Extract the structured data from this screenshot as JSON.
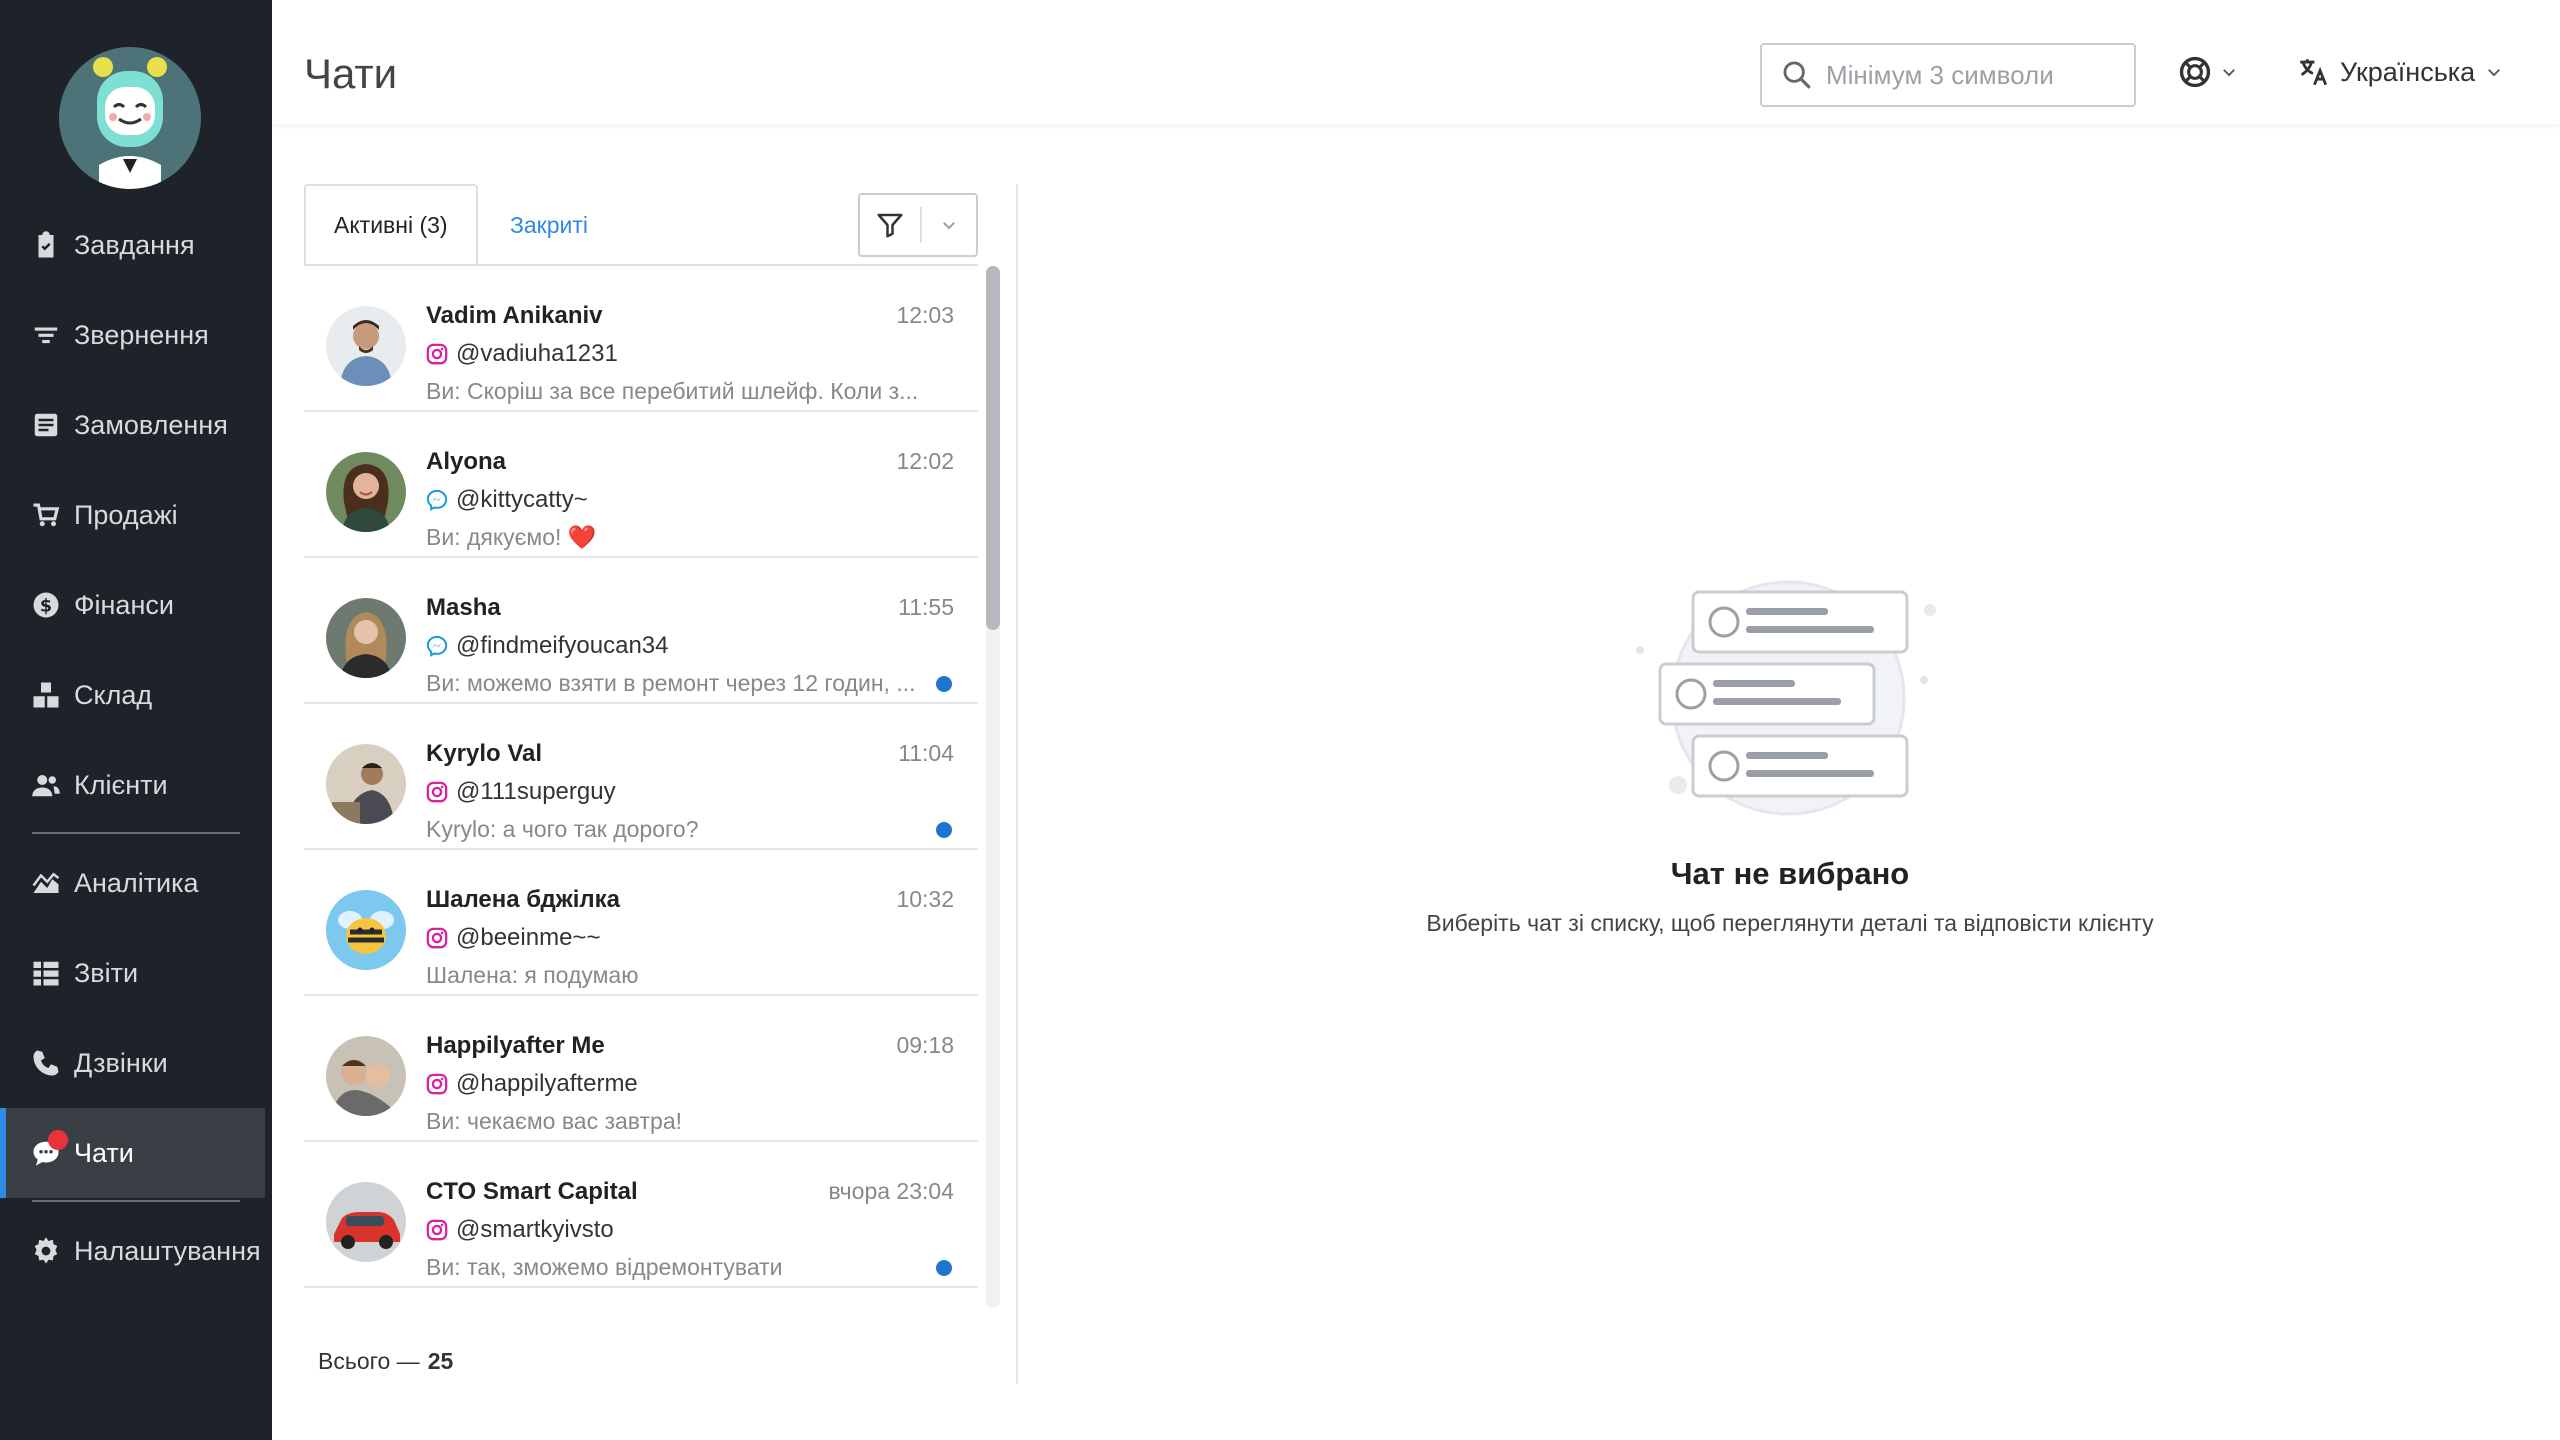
{
  "sidebar": {
    "items": [
      {
        "label": "Завдання",
        "icon": "clipboard-check-icon"
      },
      {
        "label": "Звернення",
        "icon": "filter-lines-icon"
      },
      {
        "label": "Замовлення",
        "icon": "order-list-icon"
      },
      {
        "label": "Продажі",
        "icon": "cart-icon"
      },
      {
        "label": "Фінанси",
        "icon": "dollar-icon"
      },
      {
        "label": "Склад",
        "icon": "boxes-icon"
      },
      {
        "label": "Клієнти",
        "icon": "users-icon"
      },
      {
        "label": "Аналітика",
        "icon": "area-chart-icon"
      },
      {
        "label": "Звіти",
        "icon": "table-report-icon"
      },
      {
        "label": "Дзвінки",
        "icon": "phone-icon"
      },
      {
        "label": "Чати",
        "icon": "chat-icon"
      },
      {
        "label": "Налаштування",
        "icon": "gear-icon"
      }
    ],
    "active": "Чати"
  },
  "header": {
    "title": "Чати",
    "search_placeholder": "Мінімум 3 символи",
    "language": "Українська"
  },
  "tabs": {
    "active": "Активні (3)",
    "closed": "Закриті"
  },
  "chats": [
    {
      "name": "Vadim Anikaniv",
      "time": "12:03",
      "handle": "@vadiuha1231",
      "source": "instagram",
      "message": "Ви: Скоріш за все перебитий шлейф. Коли з...",
      "unread": false
    },
    {
      "name": "Alyona",
      "time": "12:02",
      "handle": "@kittycatty~",
      "source": "messenger",
      "message": "Ви: дякуємо! ❤️",
      "unread": false
    },
    {
      "name": "Masha",
      "time": "11:55",
      "handle": "@findmeifyoucan34",
      "source": "messenger",
      "message": "Ви: можемо взяти в ремонт через 12 годин, ...",
      "unread": true
    },
    {
      "name": "Kyrylo Val",
      "time": "11:04",
      "handle": "@111superguy",
      "source": "instagram",
      "message": "Kyrylo: а чого так дорого?",
      "unread": true
    },
    {
      "name": "Шалена бджілка",
      "time": "10:32",
      "handle": "@beeinme~~",
      "source": "instagram",
      "message": "Шалена: я подумаю",
      "unread": false
    },
    {
      "name": "Happilyafter Me",
      "time": "09:18",
      "handle": "@happilyafterme",
      "source": "instagram",
      "message": "Ви: чекаємо вас завтра!",
      "unread": false
    },
    {
      "name": "CTO Smart Capital",
      "time": "вчора 23:04",
      "handle": "@smartkyivsto",
      "source": "instagram",
      "message": "Ви: так, зможемо відремонтувати",
      "unread": true
    }
  ],
  "footer": {
    "total_label": "Всього —",
    "total_value": "25"
  },
  "empty_state": {
    "title": "Чат не вибрано",
    "subtitle": "Виберіть чат зі списку, щоб переглянути деталі та відповісти клієнту"
  },
  "colors": {
    "sidebar_bg": "#1e2329",
    "accent": "#2d8ae8",
    "unread_dot": "#1f74d6",
    "badge": "#e8333a",
    "instagram": "#d6249f",
    "messenger": "#1b9bd8"
  }
}
